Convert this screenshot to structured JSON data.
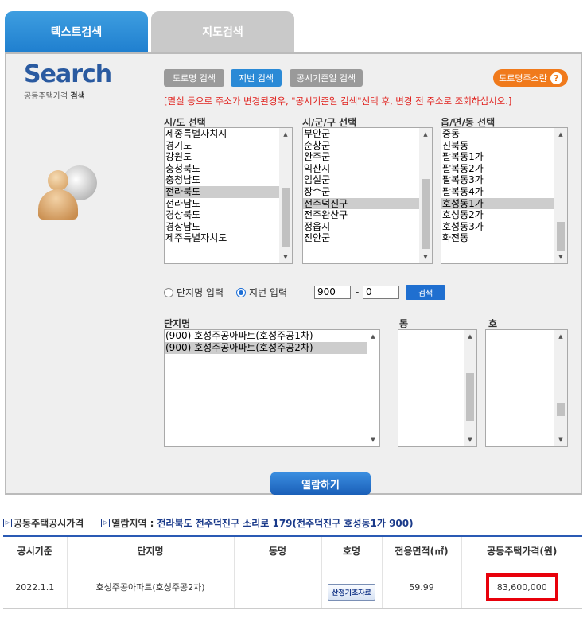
{
  "tabs": {
    "text_search": "텍스트검색",
    "map_search": "지도검색"
  },
  "logo": {
    "title": "Search",
    "subtitle_light": "공동주택가격",
    "subtitle_bold": "검색"
  },
  "modes": {
    "road": "도로명 검색",
    "lot": "지번 검색",
    "date": "공시기준일 검색"
  },
  "road_guide": {
    "label": "도로명주소란",
    "icon": "?"
  },
  "notice": "[멸실 등으로 주소가 변경된경우, \"공시기준일 검색\"선택 후, 변경 전 주소로 조회하십시오.]",
  "selectors": {
    "sido": {
      "label": "시/도 선택",
      "options": [
        "세종특별자치시",
        "경기도",
        "강원도",
        "충청북도",
        "충청남도",
        "전라북도",
        "전라남도",
        "경상북도",
        "경상남도",
        "제주특별자치도"
      ],
      "selected": "전라북도"
    },
    "sigungu": {
      "label": "시/군/구 선택",
      "options": [
        "부안군",
        "순창군",
        "완주군",
        "익산시",
        "임실군",
        "장수군",
        "전주덕진구",
        "전주완산구",
        "정읍시",
        "진안군"
      ],
      "selected": "전주덕진구"
    },
    "eupmyeondong": {
      "label": "읍/면/동 선택",
      "options": [
        "중동",
        "진북동",
        "팔복동1가",
        "팔복동2가",
        "팔복동3가",
        "팔복동4가",
        "호성동1가",
        "호성동2가",
        "호성동3가",
        "화전동"
      ],
      "selected": "호성동1가"
    }
  },
  "input_mode": {
    "complex_name": "단지명 입력",
    "lot_number": "지번 입력",
    "selected": "lot_number",
    "main_number": "900",
    "sub_number": "0",
    "dash": "-",
    "search_button": "검색"
  },
  "complex": {
    "label": "단지명",
    "options": [
      "(900) 호성주공아파트(호성주공1차)",
      "(900) 호성주공아파트(호성주공2차)"
    ],
    "selected": "(900) 호성주공아파트(호성주공2차)"
  },
  "dong": {
    "label": "동",
    "options": []
  },
  "ho": {
    "label": "호",
    "options": []
  },
  "view_button": "열람하기",
  "result_info": {
    "section_label": "공동주택공시가격",
    "area_label": "열람지역 :",
    "area_value": "전라북도 전주덕진구 소리로 179(전주덕진구 호성동1가 900)"
  },
  "table": {
    "headers": [
      "공시기준",
      "단지명",
      "동명",
      "호명",
      "전용면적(㎡)",
      "공동주택가격(원)"
    ],
    "rows": [
      {
        "date": "2022.1.1",
        "complex": "호성주공아파트(호성주공2차)",
        "dong": "",
        "ho_button": "산정기초자료",
        "area": "59.99",
        "price": "83,600,000"
      }
    ]
  },
  "colors": {
    "accent_blue": "#1f7fcf",
    "notice_red": "#e0201c",
    "highlight_red": "#e8000b",
    "guide_orange": "#f07a1c"
  }
}
